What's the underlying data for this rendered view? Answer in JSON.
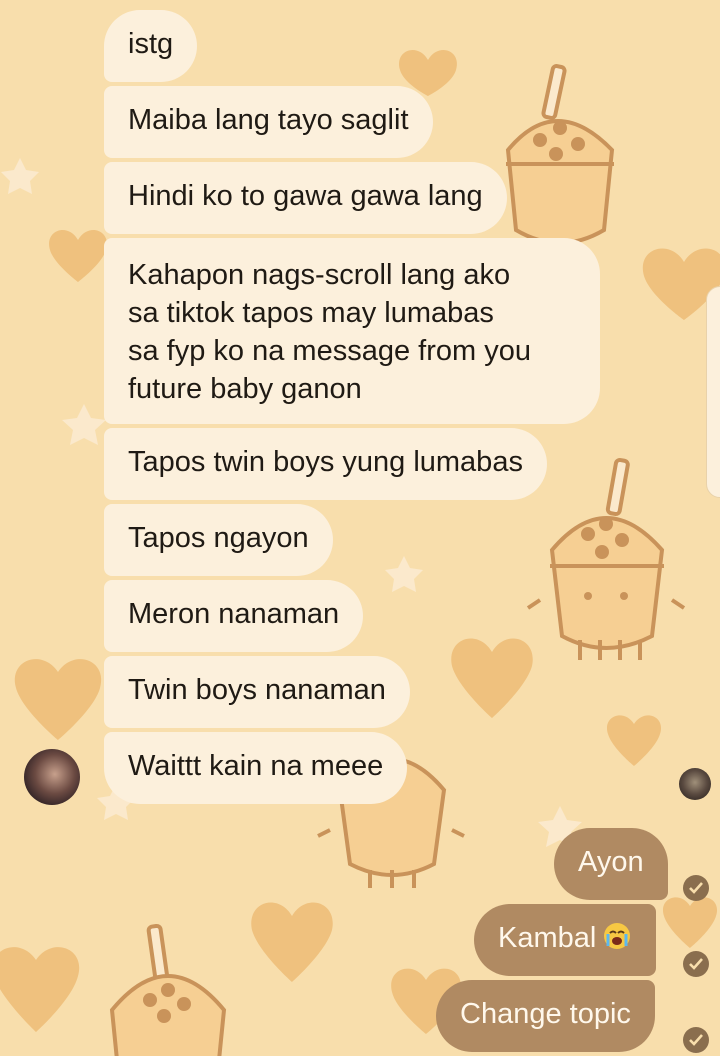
{
  "chat": {
    "incoming": [
      "istg",
      "Maiba lang tayo saglit",
      "Hindi ko to gawa gawa lang",
      "Kahapon nags-scroll lang ako\nsa tiktok tapos may lumabas\nsa fyp ko na message from you\nfuture baby ganon",
      "Tapos twin boys yung lumabas",
      "Tapos ngayon",
      "Meron nanaman",
      "Twin boys nanaman",
      "Waittt kain na meee"
    ],
    "outgoing": [
      "Ayon",
      "Kambal",
      "Change topic"
    ]
  },
  "icons": {
    "sender_avatar": "profile-photo",
    "seen_avatar": "profile-photo",
    "delivered_check": "check-circle-icon",
    "crying_emoji": "loudly-crying-face"
  },
  "colors": {
    "background": "#f8deac",
    "incoming_bubble": "#fcf0dc",
    "outgoing_bubble": "#b08a62",
    "pattern_shape": "#efc483"
  }
}
